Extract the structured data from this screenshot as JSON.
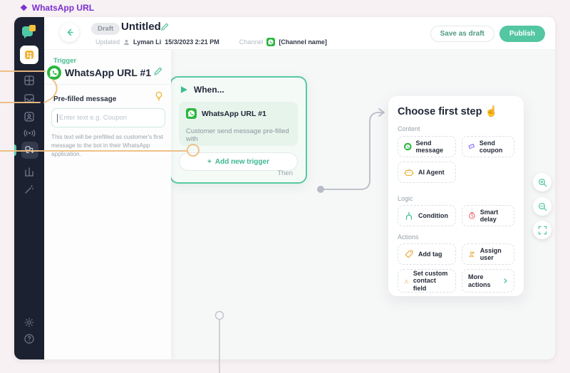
{
  "topbar": {
    "icon": "diamond",
    "title": "WhatsApp URL"
  },
  "header": {
    "draft_badge": "Draft",
    "title": "Untitled",
    "updated_label": "Updated",
    "updated_by": "Lyman Li",
    "updated_time": "15/3/2023 2:21 PM",
    "channel_label": "Channel",
    "channel_name": "[Channel name]",
    "save_draft_label": "Save as draft",
    "publish_label": "Publish"
  },
  "sidebar": {
    "icons": [
      "app-logo",
      "workspace",
      "dashboard",
      "inbox",
      "contacts",
      "broadcast",
      "flow-builder",
      "analytics",
      "magic-wand",
      "settings",
      "help"
    ]
  },
  "trigger_panel": {
    "section_label": "Trigger",
    "name": "WhatsApp URL #1",
    "field_label": "Pre-filled message",
    "input_placeholder": "Enter text e.g. Coupon",
    "help_text": "This text will be prefilled as customer's first message to the bot in their WhatsApp application."
  },
  "canvas": {
    "when_card": {
      "title": "When...",
      "trigger_name": "WhatsApp URL #1",
      "trigger_desc": "Customer send message pre-filled with",
      "add_trigger_plus": "+",
      "add_trigger_label": "Add new trigger",
      "then_label": "Then"
    },
    "choose_panel": {
      "title": "Choose first step",
      "pointer_emoji": "☝",
      "sections": [
        {
          "label": "Content",
          "items": [
            {
              "label": "Send message",
              "icon": "whatsapp"
            },
            {
              "label": "Send coupon",
              "icon": "coupon"
            },
            {
              "label": "AI Agent",
              "icon": "robot"
            }
          ]
        },
        {
          "label": "Logic",
          "items": [
            {
              "label": "Condition",
              "icon": "condition-branch"
            },
            {
              "label": "Smart delay",
              "icon": "clock"
            }
          ]
        },
        {
          "label": "Actions",
          "items": [
            {
              "label": "Add tag",
              "icon": "tag"
            },
            {
              "label": "Assign user",
              "icon": "assign-user"
            },
            {
              "label": "Set custom contact field",
              "icon": "contact-field"
            },
            {
              "label": "More actions",
              "icon": "chevron-right"
            }
          ]
        }
      ]
    },
    "zoom_controls": [
      "zoom-in",
      "zoom-out",
      "fit-screen"
    ]
  },
  "colors": {
    "accent_teal": "#53c6a2",
    "whatsapp_green": "#2bb741",
    "purple": "#7b2fd0",
    "warning_yellow": "#eaa63a",
    "danger_red": "#e5484d",
    "sidebar_dark": "#1b2130",
    "annotation_orange": "#efbe83"
  }
}
